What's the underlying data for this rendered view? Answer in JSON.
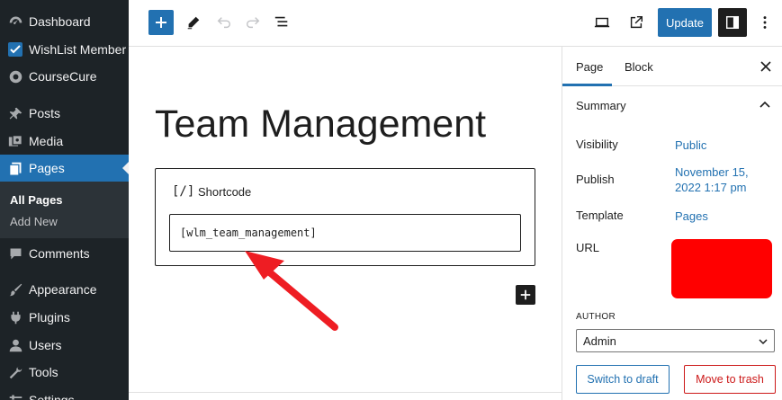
{
  "admin_menu": {
    "items": [
      {
        "label": "Dashboard",
        "icon": "dashboard-icon"
      },
      {
        "label": "WishList Member",
        "icon": "wishlist-icon"
      },
      {
        "label": "CourseCure",
        "icon": "coursecure-icon"
      },
      {
        "label": "Posts",
        "icon": "pin-icon"
      },
      {
        "label": "Media",
        "icon": "media-icon"
      },
      {
        "label": "Pages",
        "icon": "pages-icon",
        "active": true
      },
      {
        "label": "Comments",
        "icon": "comment-icon"
      },
      {
        "label": "Appearance",
        "icon": "brush-icon"
      },
      {
        "label": "Plugins",
        "icon": "plug-icon"
      },
      {
        "label": "Users",
        "icon": "users-icon"
      },
      {
        "label": "Tools",
        "icon": "wrench-icon"
      },
      {
        "label": "Settings",
        "icon": "settings-icon"
      }
    ],
    "submenu": [
      {
        "label": "All Pages",
        "current": true
      },
      {
        "label": "Add New"
      }
    ]
  },
  "toolbar": {
    "update_label": "Update",
    "icons": [
      "plus-icon",
      "pencil-icon",
      "undo-icon",
      "redo-icon",
      "list-view-icon",
      "desktop-preview-icon",
      "external-link-icon",
      "sidebar-toggle-icon",
      "more-options-icon"
    ]
  },
  "editor": {
    "title": "Team Management",
    "block_icon": "[/]",
    "block_label": "Shortcode",
    "shortcode_value": "[wlm_team_management]"
  },
  "sidebar": {
    "tabs": [
      "Page",
      "Block"
    ],
    "active_tab": "Page",
    "summary_label": "Summary",
    "rows": {
      "visibility_label": "Visibility",
      "visibility_value": "Public",
      "publish_label": "Publish",
      "publish_value_line1": "November 15,",
      "publish_value_line2": "2022 1:17 pm",
      "template_label": "Template",
      "template_value": "Pages",
      "url_label": "URL"
    },
    "author_label": "AUTHOR",
    "author_value": "Admin",
    "switch_draft_label": "Switch to draft",
    "move_trash_label": "Move to trash"
  },
  "colors": {
    "wp_blue": "#2271b1",
    "admin_dark": "#1d2327",
    "danger_red": "#cc1818",
    "annotation_red": "#ee1d23",
    "redaction": "#ff0000"
  }
}
